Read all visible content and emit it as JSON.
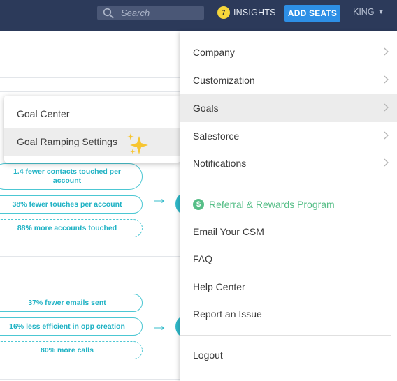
{
  "topbar": {
    "search_placeholder": "Search",
    "insights_count": "7",
    "insights_label": "INSIGHTS",
    "add_seats_label": "ADD SEATS",
    "user_label": "KING",
    "user_chevron": "▼"
  },
  "background": {
    "section1": {
      "pills": [
        "1.4 fewer contacts touched per account",
        "38% fewer touches per account",
        "88% more accounts touched"
      ]
    },
    "section2": {
      "pills": [
        "37% fewer emails sent",
        "16% less efficient in opp creation",
        "80% more calls"
      ]
    },
    "arrow": "→"
  },
  "goals_submenu": {
    "items": [
      {
        "label": "Goal Center"
      },
      {
        "label": "Goal Ramping Settings"
      }
    ]
  },
  "settings_menu": {
    "items": [
      {
        "label": "Company"
      },
      {
        "label": "Customization"
      },
      {
        "label": "Goals"
      },
      {
        "label": "Salesforce"
      },
      {
        "label": "Notifications"
      }
    ],
    "referral_icon": "$",
    "referral_label": "Referral & Rewards Program",
    "links": [
      {
        "label": "Email Your CSM"
      },
      {
        "label": "FAQ"
      },
      {
        "label": "Help Center"
      },
      {
        "label": "Report an Issue"
      }
    ],
    "logout_label": "Logout"
  },
  "colors": {
    "nav_bg": "#2c3a5a",
    "add_seats_bg": "#2d8fe6",
    "teal_accent": "#1fb2c4",
    "referral_green": "#56be87",
    "badge_yellow": "#f5d63b"
  }
}
